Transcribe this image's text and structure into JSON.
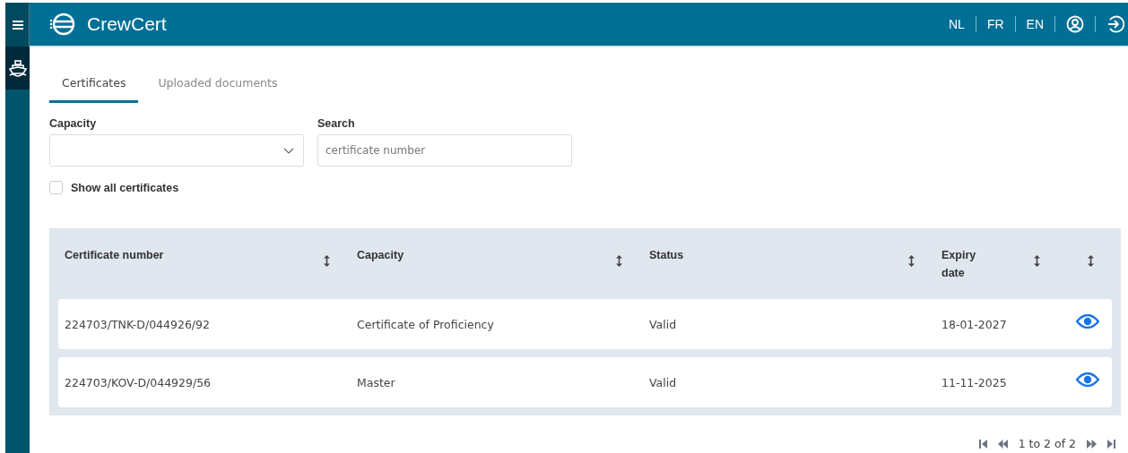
{
  "header": {
    "title": "CrewCert",
    "languages": [
      {
        "label": "NL",
        "selected": false
      },
      {
        "label": "FR",
        "selected": false
      },
      {
        "label": "EN",
        "selected": false
      }
    ]
  },
  "sidebar": {
    "items": [
      {
        "kind": "ship",
        "selected": true
      }
    ]
  },
  "tabs": [
    {
      "label": "Certificates",
      "selected": true
    },
    {
      "label": "Uploaded documents",
      "selected": false
    }
  ],
  "filters": {
    "capacity": {
      "label": "Capacity"
    },
    "search": {
      "label": "Search",
      "placeholder": "certificate number"
    },
    "show_all": {
      "label": "Show all certificates",
      "checked": false
    }
  },
  "table": {
    "columns": [
      {
        "label": "Certificate number",
        "sortable": true
      },
      {
        "label": "Capacity",
        "sortable": true
      },
      {
        "label": "Status",
        "sortable": true
      },
      {
        "label": "Expiry date",
        "sortable": true
      },
      {
        "sortable": true
      }
    ],
    "rows": [
      {
        "cells": [
          "224703/TNK-D/044926/92",
          "Certificate of Proficiency",
          "Valid",
          "18-01-2027"
        ]
      },
      {
        "cells": [
          "224703/KOV-D/044929/56",
          "Master",
          "Valid",
          "11-11-2025"
        ]
      }
    ]
  },
  "pagination": {
    "text": "1 to 2 of 2"
  }
}
